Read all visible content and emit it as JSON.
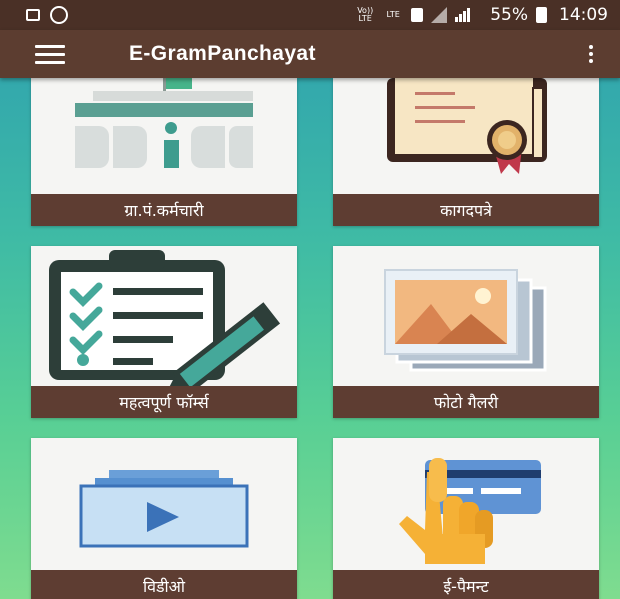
{
  "status_bar": {
    "volte_label": "Vo)) LTE",
    "lte_label": "LTE",
    "battery_percent": "55%",
    "time": "14:09"
  },
  "toolbar": {
    "title": "E-GramPanchayat",
    "menu_icon": "hamburger-menu-icon",
    "more_icon": "more-vert-icon"
  },
  "tiles": [
    {
      "label": "ग्रा.पं.कर्मचारी",
      "icon": "building-icon"
    },
    {
      "label": "कागदपत्रे",
      "icon": "certificate-icon"
    },
    {
      "label": "महत्वपूर्ण  फॉर्म्स",
      "icon": "clipboard-form-icon"
    },
    {
      "label": "फोटो  गैलरी",
      "icon": "photo-gallery-icon"
    },
    {
      "label": "विडीओ",
      "icon": "video-icon"
    },
    {
      "label": "ई-पैमन्ट",
      "icon": "card-payment-icon"
    }
  ],
  "colors": {
    "toolbar": "#5c3d30",
    "status_bar": "#4a3026",
    "tile_label": "#5e3d32",
    "background_top": "#2d9fb0",
    "background_bottom": "#7fdc8f"
  }
}
